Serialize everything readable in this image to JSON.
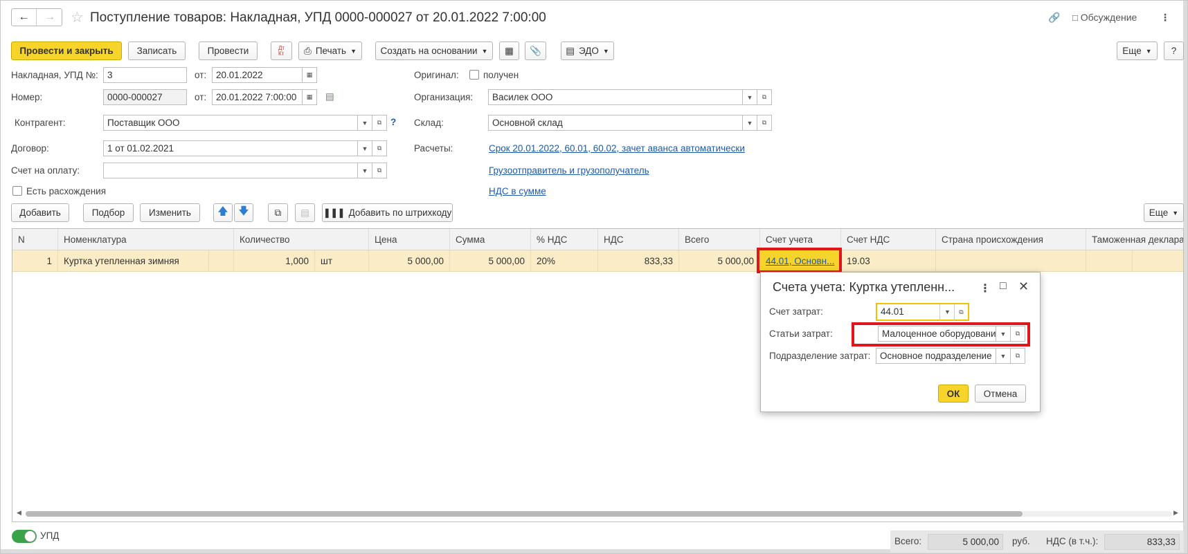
{
  "header": {
    "back_icon": "arrow-left-icon",
    "forward_icon": "arrow-right-icon",
    "favorite_icon": "star-icon",
    "title": "Поступление товаров: Накладная, УПД 0000-000027 от 20.01.2022 7:00:00",
    "link_icon": "link-icon",
    "discussion_label": "Обсуждение",
    "more_icon": "more-vertical-icon"
  },
  "toolbar": {
    "post_close": "Провести и закрыть",
    "save": "Записать",
    "post": "Провести",
    "dtkt_icon": "dt-kt-icon",
    "print": "Печать",
    "create_based": "Создать на основании",
    "edo": "ЭДО",
    "more": "Еще",
    "help": "?"
  },
  "form": {
    "invoice_label": "Накладная, УПД №:",
    "invoice_value": "3",
    "from_label": "от:",
    "invoice_date": "20.01.2022",
    "number_label": "Номер:",
    "number_value": "0000-000027",
    "number_date": "20.01.2022  7:00:00",
    "counterparty_label": "Контрагент:",
    "counterparty_value": "Поставщик ООО",
    "contract_label": "Договор:",
    "contract_value": "1 от 01.02.2021",
    "payment_invoice_label": "Счет на оплату:",
    "payment_invoice_value": "",
    "discrepancy_label": "Есть расхождения",
    "original_label": "Оригинал:",
    "original_received": "получен",
    "org_label": "Организация:",
    "org_value": "Василек ООО",
    "warehouse_label": "Склад:",
    "warehouse_value": "Основной склад",
    "settlements_label": "Расчеты:",
    "settlements_link": "Срок 20.01.2022, 60.01, 60.02, зачет аванса автоматически",
    "shipper_link": "Грузоотправитель и грузополучатель",
    "vat_link": "НДС в сумме",
    "help_mark": "?"
  },
  "table_toolbar": {
    "add": "Добавить",
    "pick": "Подбор",
    "change": "Изменить",
    "barcode": "Добавить по штрихкоду",
    "more": "Еще"
  },
  "table": {
    "columns": [
      "N",
      "Номенклатура",
      "Количество",
      "Цена",
      "Сумма",
      "% НДС",
      "НДС",
      "Всего",
      "Счет учета",
      "Счет НДС",
      "Страна происхождения",
      "Таможенная деклара"
    ],
    "row": {
      "n": "1",
      "item": "Куртка утепленная зимняя",
      "qty": "1,000",
      "unit": "шт",
      "price": "5 000,00",
      "sum": "5 000,00",
      "vat_rate": "20%",
      "vat": "833,33",
      "total": "5 000,00",
      "account": "44.01, Основн...",
      "vat_account": "19.03"
    }
  },
  "popup": {
    "title": "Счета учета: Куртка утепленн...",
    "cost_account_label": "Счет затрат:",
    "cost_account_value": "44.01",
    "cost_items_label": "Статьи затрат:",
    "cost_items_value": "Малоценное оборудование",
    "cost_dept_label": "Подразделение затрат:",
    "cost_dept_value": "Основное подразделение",
    "ok": "ОК",
    "cancel": "Отмена"
  },
  "footer": {
    "upd_label": "УПД",
    "total_label": "Всего:",
    "total_value": "5 000,00",
    "currency": "руб.",
    "vat_label": "НДС (в т.ч.):",
    "vat_value": "833,33"
  },
  "colors": {
    "accent_yellow": "#f7d42a",
    "highlight_red": "#e0161b",
    "link_blue": "#1f5aa8",
    "selected_row": "#f9ecc6",
    "toggle_green": "#3aa34a"
  }
}
